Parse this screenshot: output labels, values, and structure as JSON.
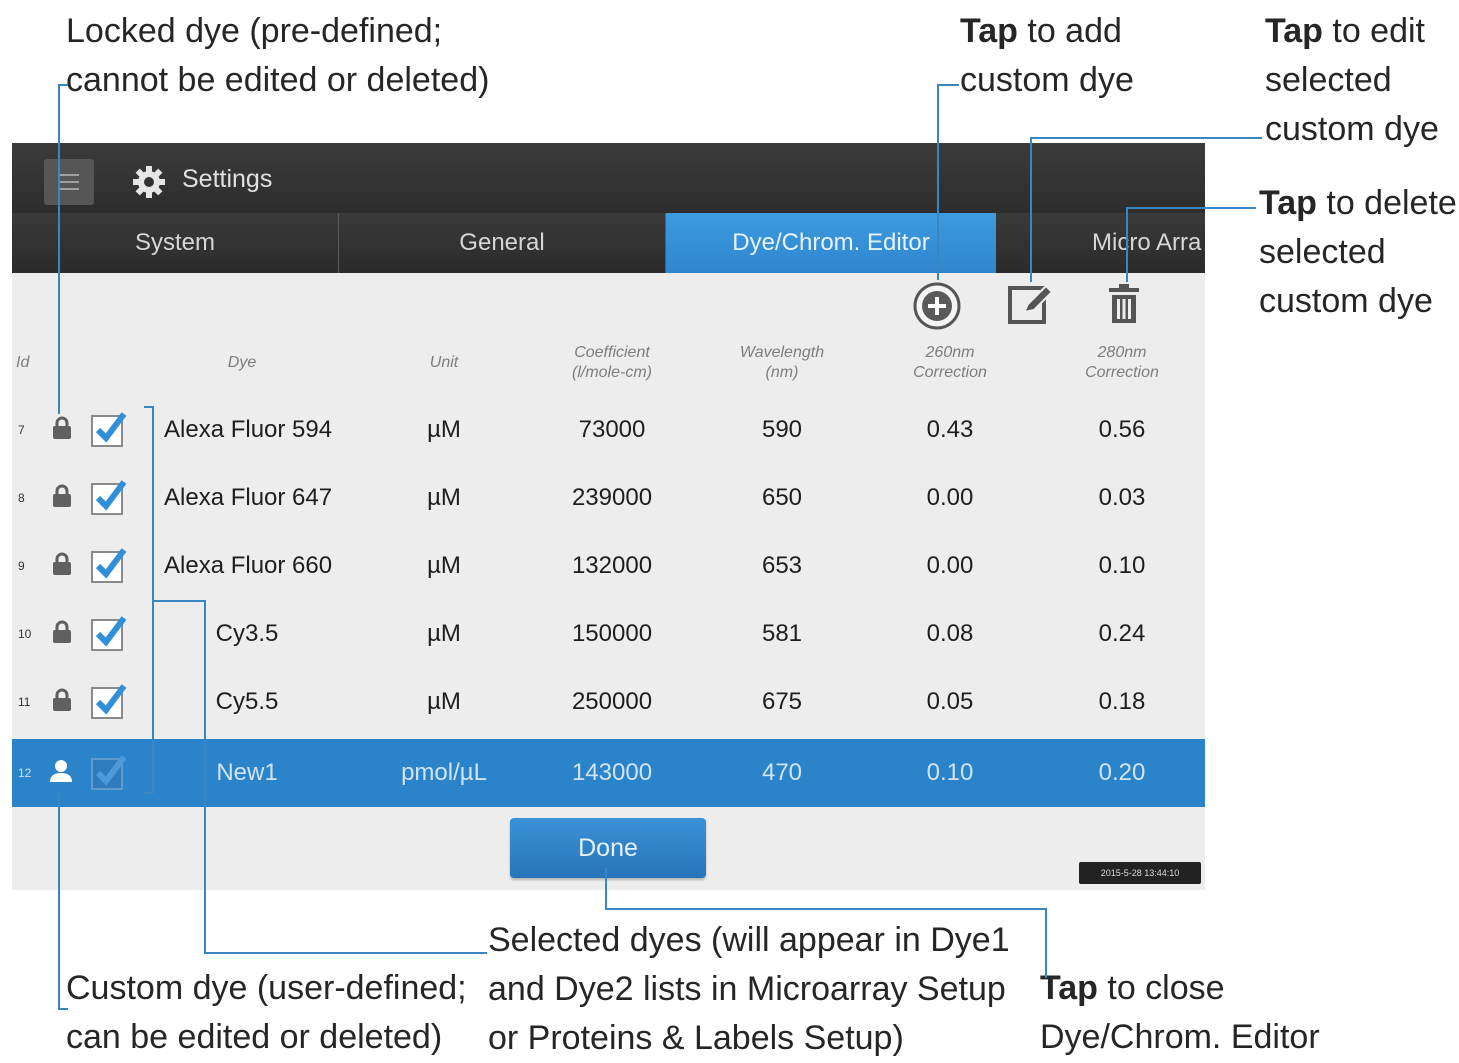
{
  "callouts": {
    "locked": [
      "Locked dye (pre-defined;",
      "cannot be edited or deleted)"
    ],
    "add": {
      "bold": "Tap",
      "rest": " to add",
      "line2": "custom dye"
    },
    "edit": {
      "bold": "Tap",
      "rest": " to edit",
      "line2": "selected",
      "line3": "custom dye"
    },
    "delete": {
      "bold": "Tap",
      "rest": " to delete",
      "line2": "selected",
      "line3": "custom dye"
    },
    "custom": [
      "Custom dye (user-defined;",
      "can be edited or deleted)"
    ],
    "selected": [
      "Selected dyes (will appear in Dye1",
      "and Dye2 lists in Microarray Setup",
      "or Proteins & Labels Setup)"
    ],
    "close": {
      "bold": "Tap",
      "rest": " to close",
      "line2": "Dye/Chrom. Editor"
    }
  },
  "app": {
    "title": "Settings",
    "tabs": [
      "System",
      "General",
      "Dye/Chrom. Editor",
      "Micro Arra"
    ],
    "active_tab": "Dye/Chrom. Editor"
  },
  "table": {
    "headers": {
      "id": "Id",
      "dye": "Dye",
      "unit": "Unit",
      "coef": [
        "Coefficient",
        "(l/mole-cm)"
      ],
      "wave": [
        "Wavelength",
        "(nm)"
      ],
      "c260": [
        "260nm",
        "Correction"
      ],
      "c280": [
        "280nm",
        "Correction"
      ]
    },
    "rows": [
      {
        "id": "7",
        "dye": "Alexa Fluor 594",
        "unit": "µM",
        "coef": "73000",
        "wave": "590",
        "c260": "0.43",
        "c280": "0.56",
        "type": "locked"
      },
      {
        "id": "8",
        "dye": "Alexa Fluor 647",
        "unit": "µM",
        "coef": "239000",
        "wave": "650",
        "c260": "0.00",
        "c280": "0.03",
        "type": "locked"
      },
      {
        "id": "9",
        "dye": "Alexa Fluor 660",
        "unit": "µM",
        "coef": "132000",
        "wave": "653",
        "c260": "0.00",
        "c280": "0.10",
        "type": "locked"
      },
      {
        "id": "10",
        "dye": "Cy3.5",
        "unit": "µM",
        "coef": "150000",
        "wave": "581",
        "c260": "0.08",
        "c280": "0.24",
        "type": "locked"
      },
      {
        "id": "11",
        "dye": "Cy5.5",
        "unit": "µM",
        "coef": "250000",
        "wave": "675",
        "c260": "0.05",
        "c280": "0.18",
        "type": "locked"
      },
      {
        "id": "12",
        "dye": "New1",
        "unit": "pmol/µL",
        "coef": "143000",
        "wave": "470",
        "c260": "0.10",
        "c280": "0.20",
        "type": "custom"
      }
    ]
  },
  "done_label": "Done",
  "timestamp": "2015-5-28 13:44:10",
  "colors": {
    "accent": "#2b83ca",
    "callout_line": "#3a86c0",
    "topbar": "#333333"
  }
}
